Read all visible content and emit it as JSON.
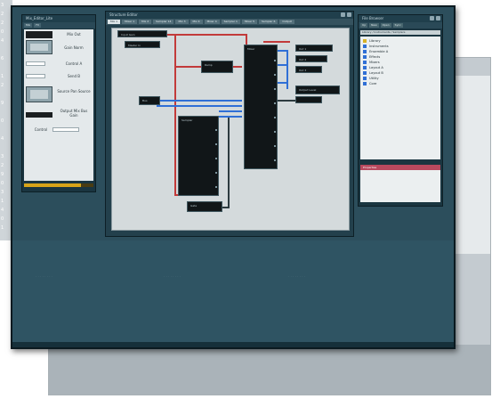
{
  "background_window": {
    "color": "#c4cbd0"
  },
  "ruler": {
    "numbers": [
      "3",
      "2",
      "2",
      "0",
      "4",
      "",
      "6",
      "",
      "1",
      "2",
      "",
      "9",
      "",
      "0",
      "",
      "4",
      "",
      "3",
      "2",
      "9",
      "0",
      "3",
      "1",
      "4",
      "0",
      "1"
    ]
  },
  "left_panel": {
    "title": "Mix_Editor_Lite",
    "tabs": [
      "Mix",
      "FX"
    ],
    "rows": [
      "Mix Out",
      "Gain Norm",
      "Control A",
      "Send B",
      "Source Pan Source",
      "Output Mix Bus Gain",
      "Control"
    ],
    "progress": 0.82
  },
  "center_panel": {
    "title": "Structure Editor",
    "tabs": [
      "Mix 1",
      "Mixer 1",
      "Mix 2",
      "Sampler 14",
      "Mix 3",
      "Mix 4",
      "Mixer 4",
      "Sampler 1",
      "Mixer 5",
      "Sampler 6",
      "Output"
    ],
    "nodes": {
      "input_a": "Input Gain",
      "input_b": "Master In",
      "mixer": "Mixer",
      "bus_node": "Bus",
      "ramp": "Ramp",
      "sampler": "Sampler",
      "gate": "Gate",
      "out_1": "Out 1",
      "out_2": "Out 2",
      "out_3": "Out 3",
      "out_4": "Output Level"
    }
  },
  "right_panel": {
    "title": "File Browser",
    "toolbar": [
      "Up",
      "New",
      "Open",
      "Sync"
    ],
    "path": "Library / Instruments / Samplers",
    "items": [
      "Library",
      "Instruments",
      "Ensemble A",
      "Effects",
      "Mixers",
      "Layout A",
      "Layout B",
      "Utility",
      "Core"
    ],
    "inspector_label": "Properties"
  }
}
